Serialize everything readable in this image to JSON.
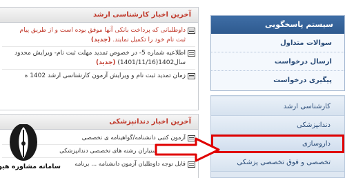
{
  "news_latest_masters": {
    "title": "آخرین اخبار کارشناسی ارشد",
    "items": [
      {
        "lines": [
          "داوطلبانی که پرداخت بانکی آنها موفق بوده است و از طریق پیام",
          "ثبت نام خود را تکمیل نمایند."
        ],
        "new_label": "(جدید)"
      },
      {
        "lines": [
          "اطلاعیه شماره 5- در خصوص تمدید مهلت ثبت نام- ویرایش محدود",
          "سال1402(1401/11/16)"
        ],
        "new_label": "(جدید)"
      },
      {
        "lines": [
          "زمان تمدید ثبت نام و ویرایش آزمون کارشناسی ارشد 1402 ه"
        ],
        "new_label": ""
      }
    ]
  },
  "news_latest_dental": {
    "title": "آخرین اخبار دندانپزشکی",
    "items": [
      {
        "line": "آزمون کتبی دانشنامه/گواهینامه ی تخصصی"
      },
      {
        "line": "قابل توجه دستیاران رشته های تخصصی دندانپزشکی"
      },
      {
        "line": "قابل توجه داوطلبان آزمون دانشنامه ... برنامه"
      }
    ]
  },
  "sidebar_top": {
    "title": "سیستم پاسخگویی",
    "items": [
      "سوالات متداول",
      "ارسال درخواست",
      "پیگیری درخواست"
    ]
  },
  "sidebar_menu": {
    "items": [
      "کارشناسی ارشد",
      "دندانپزشکی",
      "داروسازی",
      "تخصصی و فوق تخصصی پزشکی"
    ]
  },
  "logo": {
    "text": "سامانه مشاوره هیوا"
  },
  "colors": {
    "accent_red": "#e00000",
    "blue_header": "#2e5a8f"
  }
}
